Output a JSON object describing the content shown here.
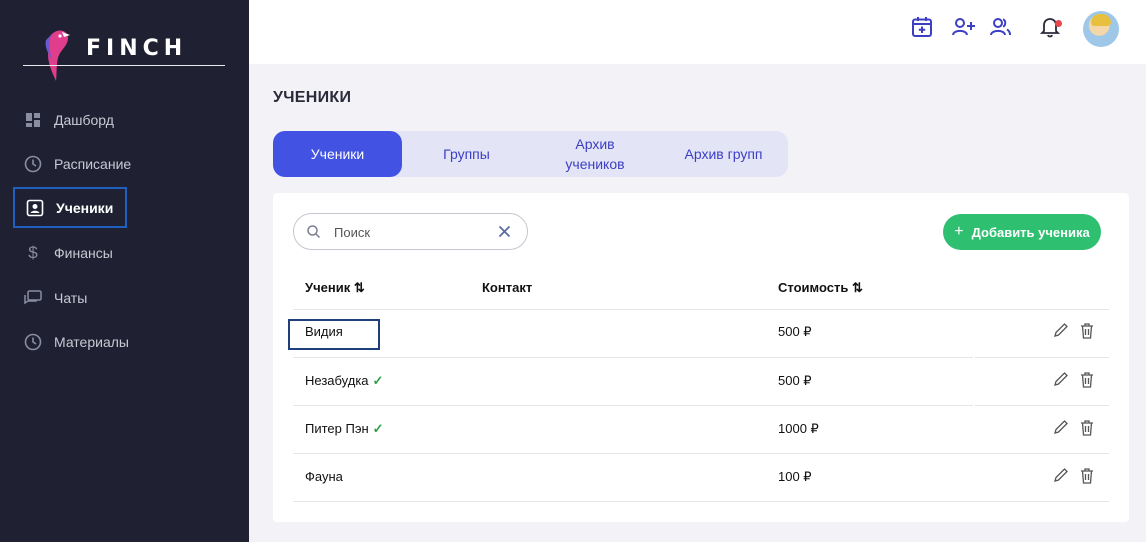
{
  "brand": {
    "name": "FINCH"
  },
  "sidebar": {
    "items": [
      {
        "label": "Дашборд",
        "icon": "dashboard-icon"
      },
      {
        "label": "Расписание",
        "icon": "clock-icon"
      },
      {
        "label": "Ученики",
        "icon": "student-card-icon",
        "active": true
      },
      {
        "label": "Финансы",
        "icon": "dollar-icon"
      },
      {
        "label": "Чаты",
        "icon": "chat-icon"
      },
      {
        "label": "Материалы",
        "icon": "clock-icon"
      }
    ]
  },
  "header": {
    "icons": [
      "calendar-add-icon",
      "user-add-icon",
      "users-icon",
      "bell-icon",
      "avatar"
    ],
    "notification_dot_color": "#e5484d"
  },
  "page": {
    "title": "УЧЕНИКИ"
  },
  "tabs": [
    {
      "label": "Ученики",
      "active": true
    },
    {
      "label": "Группы"
    },
    {
      "label": "Архив учеников"
    },
    {
      "label": "Архив групп"
    }
  ],
  "search": {
    "placeholder": "Поиск",
    "value": ""
  },
  "add_button": {
    "label": "Добавить ученика"
  },
  "table": {
    "columns": {
      "student": "Ученик",
      "contact": "Контакт",
      "cost": "Стоимость"
    },
    "rows": [
      {
        "name": "Видия",
        "contact": "",
        "cost": "500 ₽",
        "verified": false
      },
      {
        "name": "Незабудка",
        "contact": "",
        "cost": "500 ₽",
        "verified": true
      },
      {
        "name": "Питер Пэн",
        "contact": "",
        "cost": "1000 ₽",
        "verified": true
      },
      {
        "name": "Фауна",
        "contact": "",
        "cost": "100 ₽",
        "verified": false
      }
    ]
  },
  "colors": {
    "sidebar_bg": "#1f2133",
    "accent": "#4253e4",
    "add_button": "#2fbf71",
    "check": "#2e9e4a"
  }
}
